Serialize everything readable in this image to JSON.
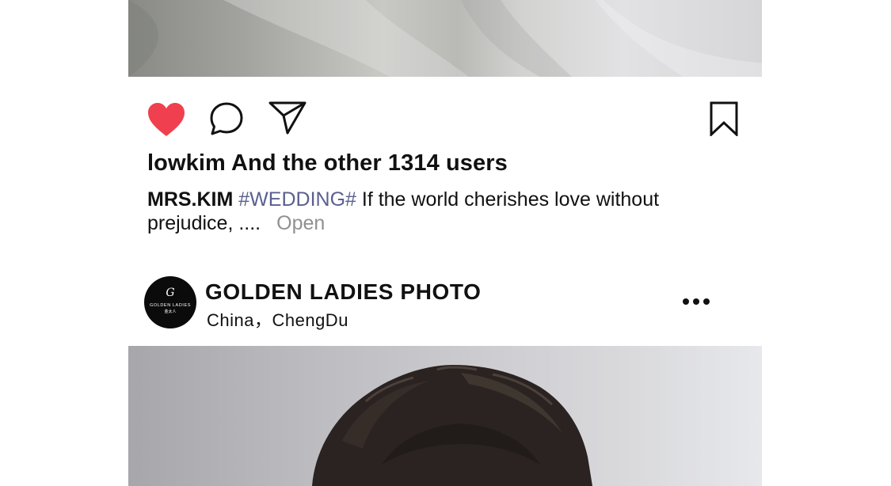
{
  "post_top": {
    "actions": {
      "like_icon": "heart-filled-icon",
      "comment_icon": "speech-bubble-icon",
      "share_icon": "paper-plane-icon",
      "save_icon": "bookmark-icon",
      "like_color": "#f0404f"
    },
    "likes_text": "lowkim And the other 1314 users",
    "caption": {
      "author": "MRS.KIM",
      "hashtag": "#WEDDING#",
      "text": "If the world cherishes love without prejudice, ....",
      "open_label": "Open"
    }
  },
  "post_next": {
    "avatar": {
      "monogram": "G",
      "brand": "GOLDEN LADIES",
      "brand_sub": "金太人"
    },
    "account_name": "GOLDEN LADIES PHOTO",
    "location": "China，ChengDu",
    "more_icon": "ellipsis-icon"
  },
  "colors": {
    "hashtag": "#5a5f8e",
    "muted": "#909090",
    "text": "#111111"
  }
}
